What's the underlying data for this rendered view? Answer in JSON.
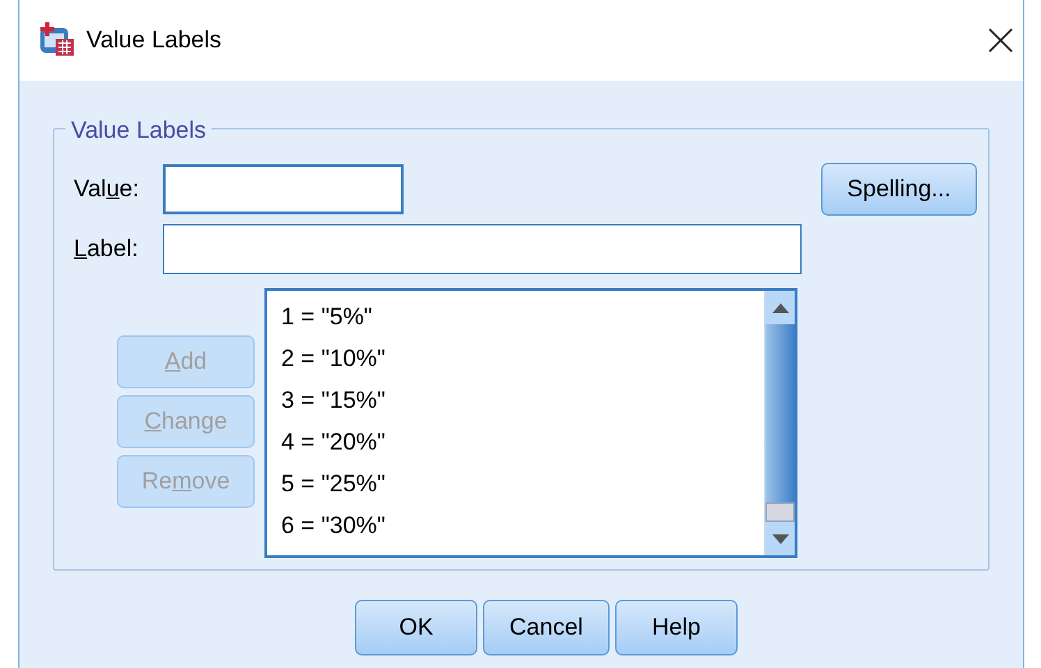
{
  "window": {
    "title": "Value Labels"
  },
  "group": {
    "title": "Value Labels"
  },
  "value_field": {
    "label_parts": {
      "before": "Val",
      "key": "u",
      "after": "e:"
    }
  },
  "label_field": {
    "label_parts": {
      "key": "L",
      "after": "abel:"
    }
  },
  "spelling_button": "Spelling...",
  "side_buttons": [
    {
      "parts": {
        "key": "A",
        "after": "dd"
      },
      "disabled": true
    },
    {
      "parts": {
        "key": "C",
        "after": "hange"
      },
      "disabled": true
    },
    {
      "parts": {
        "before": "Re",
        "key": "m",
        "after": "ove"
      },
      "disabled": true
    }
  ],
  "list": {
    "items": [
      {
        "text": "1 = \"5%\"",
        "selected": false
      },
      {
        "text": "2 = \"10%\"",
        "selected": false
      },
      {
        "text": "3 = \"15%\"",
        "selected": false
      },
      {
        "text": "4 = \"20%\"",
        "selected": false
      },
      {
        "text": "5 = \"25%\"",
        "selected": false
      },
      {
        "text": "6 = \"30%\"",
        "selected": false
      }
    ]
  },
  "buttons": [
    "OK",
    "Cancel",
    "Help"
  ]
}
